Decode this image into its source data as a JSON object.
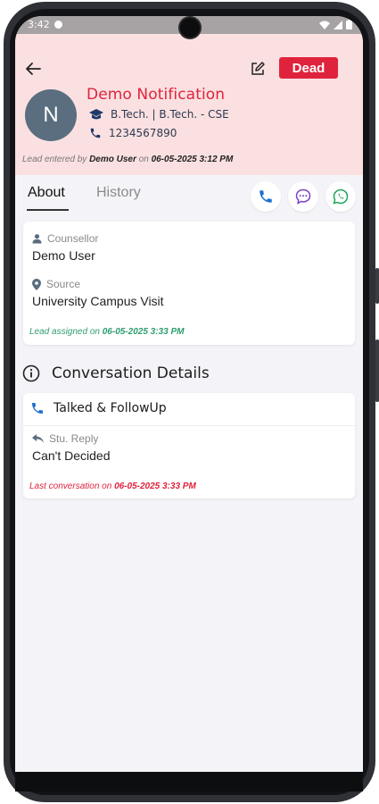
{
  "status_bar": {
    "time": "3:42"
  },
  "header": {
    "badge": "Dead",
    "avatar_letter": "N",
    "lead_name": "Demo Notification",
    "course": "B.Tech.  |  B.Tech. - CSE",
    "phone": "1234567890",
    "entered_prefix": "Lead entered by ",
    "entered_user": "Demo User",
    "entered_mid": " on ",
    "entered_date": "06-05-2025 3:12 PM"
  },
  "tabs": {
    "about": "About",
    "history": "History"
  },
  "about": {
    "counsellor_label": "Counsellor",
    "counsellor_value": "Demo User",
    "source_label": "Source",
    "source_value": "University Campus Visit",
    "assigned_prefix": "Lead assigned on ",
    "assigned_date": "06-05-2025 3:33 PM"
  },
  "conversation": {
    "title": "Conversation Details",
    "type": "Talked & FollowUp",
    "reply_label": "Stu. Reply",
    "reply_value": "Can't Decided",
    "last_prefix": "Last conversation on ",
    "last_date": "06-05-2025 3:33 PM"
  },
  "colors": {
    "header_bg": "#fbe0e1",
    "dead": "#e0233c",
    "accent": "#1f6fd1",
    "whatsapp": "#1ea65a",
    "sms": "#7b3fc4",
    "assigned": "#2e9e6e"
  }
}
